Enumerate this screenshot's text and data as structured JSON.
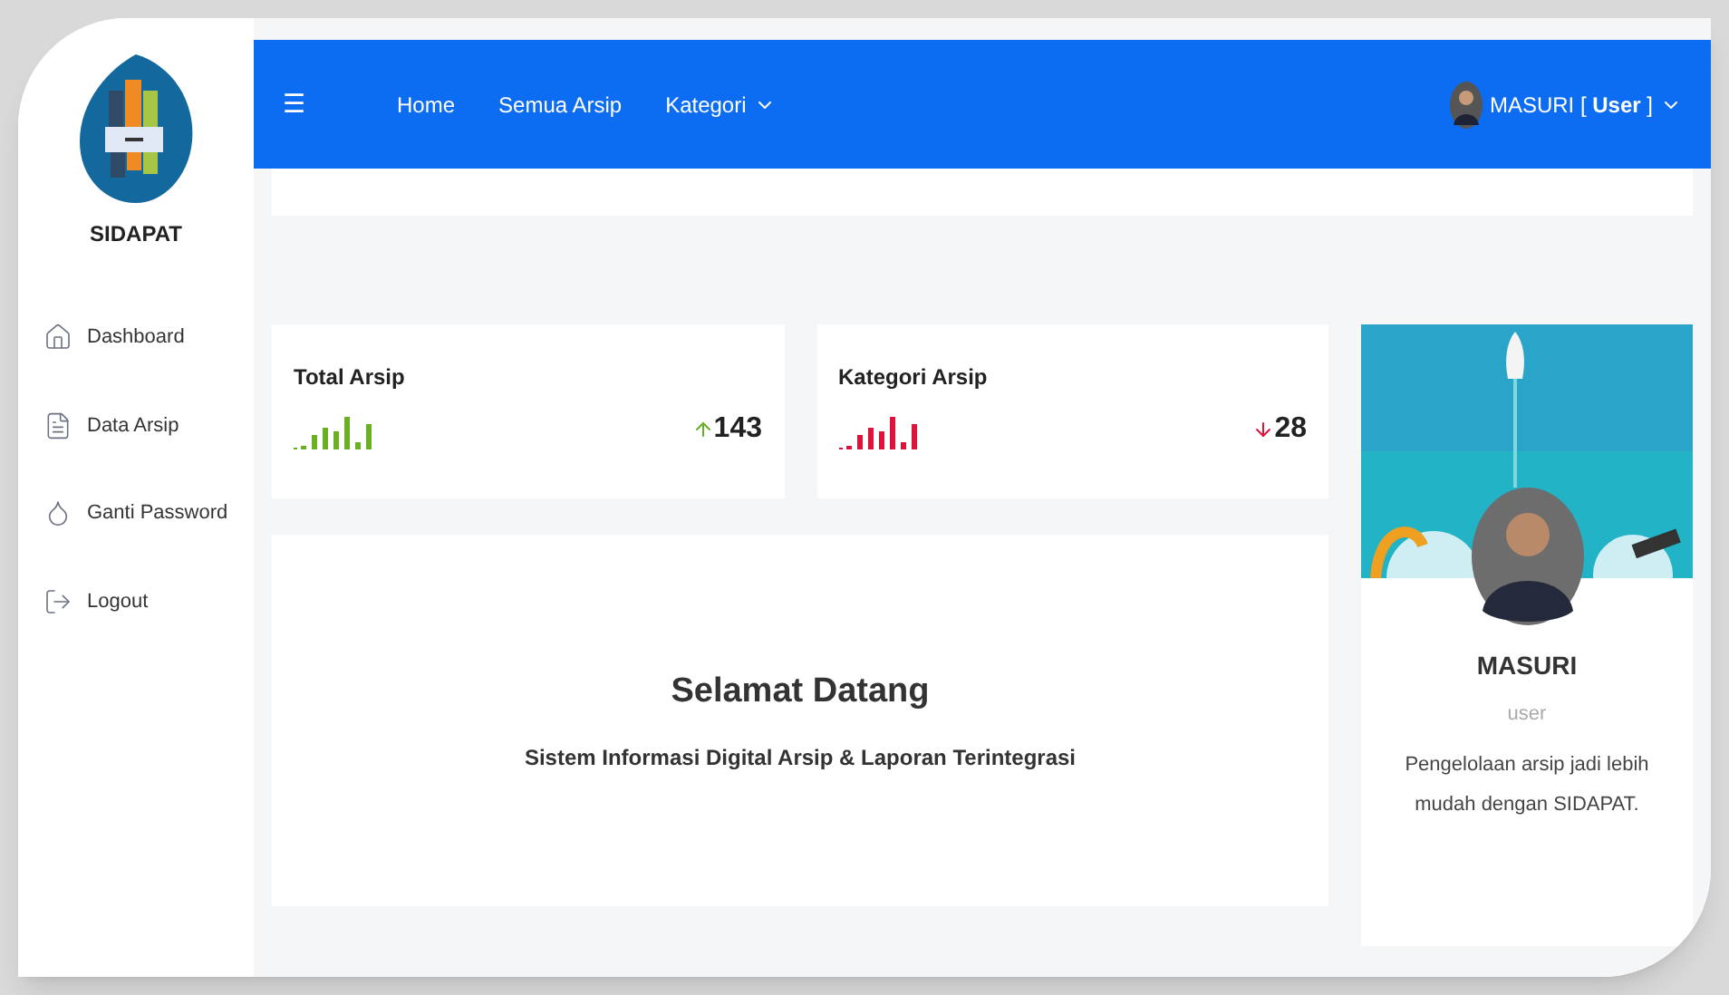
{
  "brand": {
    "name": "SIDAPAT"
  },
  "sidebar": {
    "items": [
      {
        "label": "Dashboard",
        "kind": "home"
      },
      {
        "label": "Data Arsip",
        "kind": "file"
      },
      {
        "label": "Ganti Password",
        "kind": "drop"
      },
      {
        "label": "Logout",
        "kind": "logout"
      }
    ]
  },
  "navbar": {
    "menu_icon": "☰",
    "links": [
      {
        "label": "Home",
        "dropdown": false
      },
      {
        "label": "Semua Arsip",
        "dropdown": false
      },
      {
        "label": "Kategori",
        "dropdown": true
      }
    ],
    "user": {
      "name": "MASURI [ ",
      "role": "User",
      "suffix": " ]"
    }
  },
  "stats": [
    {
      "title": "Total Arsip",
      "value": "143",
      "kind": "up",
      "color": "#6ab023"
    },
    {
      "title": "Kategori Arsip",
      "value": "28",
      "kind": "down",
      "color": "#dc143c"
    }
  ],
  "welcome": {
    "title": "Selamat Datang",
    "subtitle": "Sistem Informasi Digital Arsip & Laporan Terintegrasi"
  },
  "profile": {
    "name": "MASURI",
    "role": "user",
    "text": "Pengelolaan arsip jadi lebih mudah dengan SIDAPAT."
  }
}
